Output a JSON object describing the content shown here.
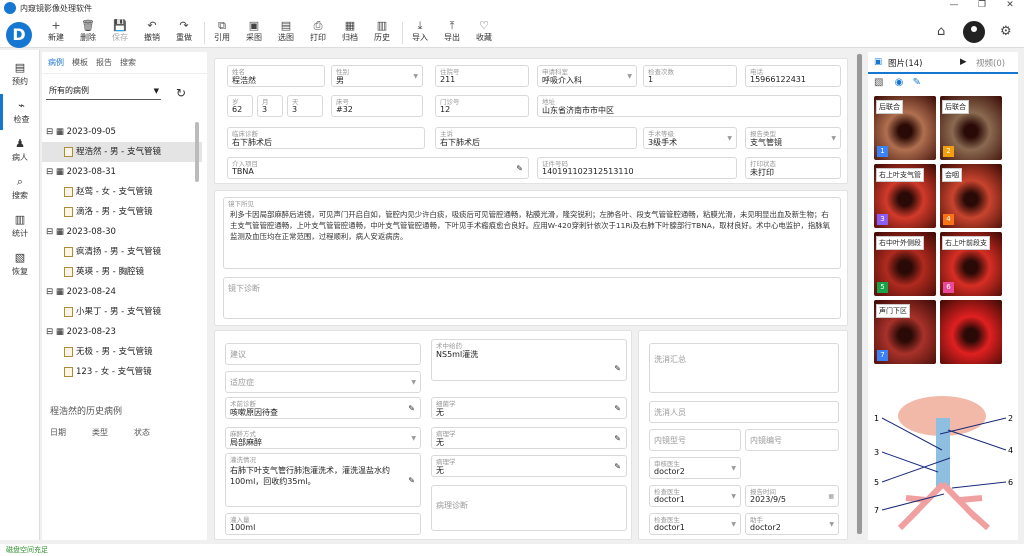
{
  "app": {
    "title": "内窥镜影像处理软件",
    "window_controls": [
      "—",
      "❐",
      "✕"
    ]
  },
  "toolbar": {
    "buttons": [
      {
        "label": "新建",
        "icon": "new-icon",
        "glyph": "+"
      },
      {
        "label": "删除",
        "icon": "delete-icon",
        "glyph": "🗑"
      },
      {
        "label": "保存",
        "icon": "save-icon",
        "glyph": "💾"
      },
      {
        "label": "撤销",
        "icon": "undo-icon",
        "glyph": "↶"
      },
      {
        "label": "重做",
        "icon": "redo-icon",
        "glyph": "↷"
      },
      {
        "label": "引用",
        "icon": "quote-icon",
        "glyph": "⧉"
      },
      {
        "label": "采图",
        "icon": "capture-icon",
        "glyph": "▣"
      },
      {
        "label": "选图",
        "icon": "select-image-icon",
        "glyph": "▤"
      },
      {
        "label": "打印",
        "icon": "print-icon",
        "glyph": "⎙"
      },
      {
        "label": "归档",
        "icon": "archive-icon",
        "glyph": "▦"
      },
      {
        "label": "历史",
        "icon": "history-icon",
        "glyph": "▥"
      },
      {
        "label": "导入",
        "icon": "import-icon",
        "glyph": "⤓"
      },
      {
        "label": "导出",
        "icon": "export-icon",
        "glyph": "⤒"
      },
      {
        "label": "收藏",
        "icon": "favorite-icon",
        "glyph": "♡"
      }
    ]
  },
  "nav": [
    {
      "label": "预约",
      "glyph": "▤"
    },
    {
      "label": "检查",
      "glyph": "⌁"
    },
    {
      "label": "病人",
      "glyph": "♟"
    },
    {
      "label": "搜索",
      "glyph": "⌕"
    },
    {
      "label": "统计",
      "glyph": "▥"
    },
    {
      "label": "恢复",
      "glyph": "▧"
    }
  ],
  "sidebar": {
    "tabs": [
      "病例",
      "模板",
      "报告",
      "搜索"
    ],
    "filter": "所有的病例",
    "tree": [
      {
        "date": "2023-09-05",
        "items": [
          "程浩然 - 男 - 支气管镜"
        ]
      },
      {
        "date": "2023-08-31",
        "items": [
          "赵莺 - 女 - 支气管镜",
          "滴洛 - 男 - 支气管镜"
        ]
      },
      {
        "date": "2023-08-30",
        "items": [
          "疯清扬 - 男 - 支气管镜",
          "英瑛 - 男 - 胸腔镜"
        ]
      },
      {
        "date": "2023-08-24",
        "items": [
          "小果丁 - 男 - 支气管镜"
        ]
      },
      {
        "date": "2023-08-23",
        "items": [
          "无极 - 男 - 支气管镜",
          "123 - 女 - 支气管镜"
        ]
      }
    ],
    "history_title": "程浩然的历史病例",
    "history_cols": [
      "日期",
      "类型",
      "状态"
    ]
  },
  "form": {
    "name": {
      "label": "姓名",
      "value": "程浩然"
    },
    "gender": {
      "label": "性别",
      "value": "男"
    },
    "inpatient": {
      "label": "住院号",
      "value": "211"
    },
    "dept": {
      "label": "申请科室",
      "value": "呼吸介入科"
    },
    "exam_count": {
      "label": "检查次数",
      "value": "1"
    },
    "phone": {
      "label": "电话",
      "value": "15966122431"
    },
    "age_y": {
      "label": "岁",
      "value": "62"
    },
    "age_m": {
      "label": "月",
      "value": "3"
    },
    "age_d": {
      "label": "天",
      "value": "3"
    },
    "bed": {
      "label": "床号",
      "value": "#32"
    },
    "clinic": {
      "label": "门诊号",
      "value": "12"
    },
    "address": {
      "label": "地址",
      "value": "山东省济南市市中区"
    },
    "clinical_dx": {
      "label": "临床诊断",
      "value": "右下肺术后"
    },
    "complaint": {
      "label": "主诉",
      "value": "右下肺术后"
    },
    "surgery_level": {
      "label": "手术等级",
      "value": "3级手术"
    },
    "report_type": {
      "label": "报告类型",
      "value": "支气管镜"
    },
    "intervention": {
      "label": "介入项目",
      "value": "TBNA"
    },
    "id_no": {
      "label": "证件号码",
      "value": "140191102312513110"
    },
    "print_status": {
      "label": "打印状态",
      "value": "未打印"
    }
  },
  "findings": {
    "label": "镜下所见",
    "text": "利多卡因局部麻醉后进镜，可见声门开启自如，管腔内见少许白痰，吸痰后可见管腔通畅，粘膜光滑，隆突锐利；左肺各叶、段支气管管腔通畅，粘膜光滑，未见明显出血及新生物；右主支气管管腔通畅，上叶支气管管腔通畅，中叶支气管管腔通畅，下叶见手术瘢痕愈合良好。应用W-420穿刺针依次于11Ri及右肺下叶腺部行TBNA，取材良好。术中心电监护，指脉氧监测及血压均在正常范围，过程顺利，病人安返病房。",
    "diagnosis_placeholder": "镜下诊断"
  },
  "lower": {
    "suggestion": "建议",
    "indication": "适应症",
    "anesthesia_drug": {
      "label": "术中给药",
      "value": "NS5ml灌洗"
    },
    "postop_dx": {
      "label": "术前诊断",
      "value": "咳嗽原因待查"
    },
    "bacteriology": {
      "label": "细菌学",
      "value": "无"
    },
    "anesthesia": {
      "label": "麻醉方式",
      "value": "局部麻醉"
    },
    "pathology": {
      "label": "病理学",
      "value": "无"
    },
    "lavage": {
      "label": "灌洗情况",
      "value": "右肺下叶支气管行肺泡灌洗术，灌洗温盐水约100ml，回收约35ml。"
    },
    "cytology": {
      "label": "病理学",
      "value": "无"
    },
    "pathology_dx": "病理诊断",
    "inject": {
      "label": "灌入量",
      "value": "100ml"
    },
    "wash_summary": "洗消汇总",
    "wash_staff": "洗消人员",
    "scope_model": "内镜型号",
    "scope_no": "内镜编号",
    "reviewer": {
      "label": "审核医生",
      "value": "doctor2"
    },
    "examiner": {
      "label": "检查医生",
      "value": "doctor1"
    },
    "report_time": {
      "label": "报告时间",
      "value": "2023/9/5"
    },
    "examiner2": {
      "label": "检查医生",
      "value": "doctor1"
    },
    "assistant": {
      "label": "助手",
      "value": "doctor2"
    }
  },
  "images": {
    "tab_photos": "图片(14)",
    "tab_video": "视频(0)",
    "thumbs": [
      {
        "tag": "后联合",
        "num": "1",
        "color": "#b07050",
        "numcolor": "#3b82f6"
      },
      {
        "tag": "后联合",
        "num": "2",
        "color": "#8a6a50",
        "numcolor": "#f59e0b"
      },
      {
        "tag": "右上叶支气管",
        "num": "3",
        "color": "#d23a2a",
        "numcolor": "#8b5cf6"
      },
      {
        "tag": "会咽",
        "num": "4",
        "color": "#c8442e",
        "numcolor": "#f97316"
      },
      {
        "tag": "右中叶外侧段",
        "num": "5",
        "color": "#b02a1e",
        "numcolor": "#16a34a"
      },
      {
        "tag": "右上叶前段支",
        "num": "6",
        "color": "#d82e24",
        "numcolor": "#ec4899"
      },
      {
        "tag": "声门下区",
        "num": "7",
        "color": "#a8322a",
        "numcolor": "#3b82f6"
      },
      {
        "tag": "",
        "num": "",
        "color": "#e02020",
        "numcolor": "#e02020"
      }
    ],
    "diagram_labels": [
      "1",
      "2",
      "3",
      "4",
      "5",
      "6",
      "7"
    ]
  },
  "status": "磁盘空间充足"
}
